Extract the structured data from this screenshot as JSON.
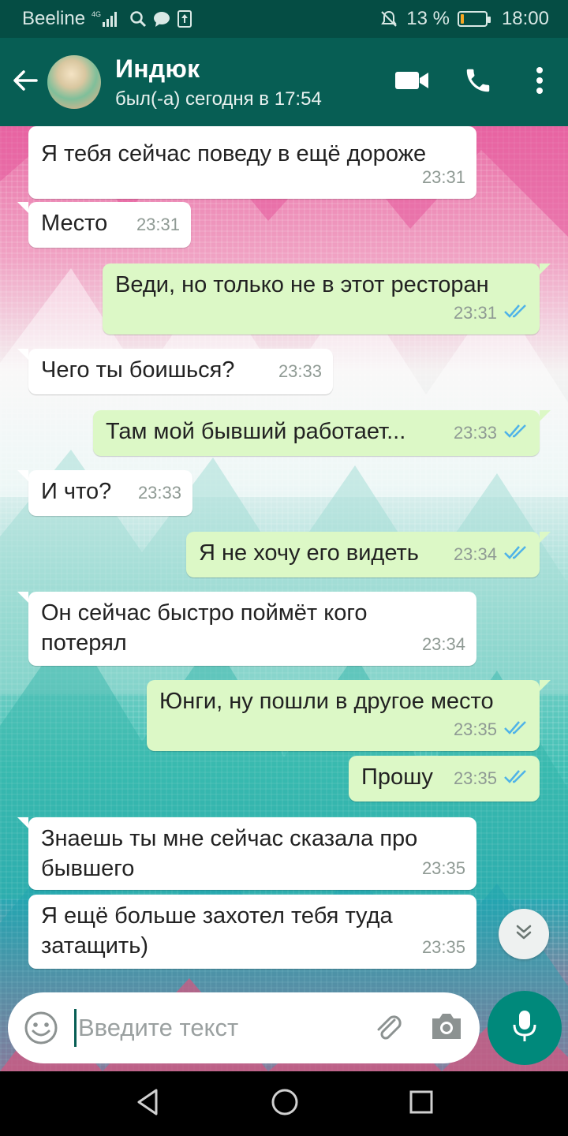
{
  "statusbar": {
    "carrier": "Beeline",
    "network": "4G",
    "battery_text": "13 %",
    "battery_level": 0.13,
    "time": "18:00"
  },
  "header": {
    "contact_name": "Индюк",
    "last_seen": "был(-а) сегодня в 17:54"
  },
  "messages": [
    {
      "dir": "in",
      "text": "Я тебя сейчас поведу в ещё дороже",
      "time": "23:31"
    },
    {
      "dir": "in",
      "text": "Место",
      "time": "23:31"
    },
    {
      "dir": "out",
      "text": "Веди, но только не в этот ресторан",
      "time": "23:31"
    },
    {
      "dir": "in",
      "text": "Чего ты боишься?",
      "time": "23:33"
    },
    {
      "dir": "out",
      "text": "Там мой бывший работает...",
      "time": "23:33"
    },
    {
      "dir": "in",
      "text": "И что?",
      "time": "23:33"
    },
    {
      "dir": "out",
      "text": "Я не хочу его видеть",
      "time": "23:34"
    },
    {
      "dir": "in",
      "text": "Он сейчас быстро поймёт кого потерял",
      "time": "23:34"
    },
    {
      "dir": "out",
      "text": "Юнги, ну пошли в другое место",
      "time": "23:35"
    },
    {
      "dir": "out",
      "text": "Прошу",
      "time": "23:35"
    },
    {
      "dir": "in",
      "text": "Знаешь ты мне сейчас сказала про бывшего",
      "time": "23:35"
    },
    {
      "dir": "in",
      "text": "Я ещё больше захотел тебя туда затащить)",
      "time": "23:35"
    }
  ],
  "input": {
    "placeholder": "Введите текст"
  },
  "colors": {
    "header": "#075e54",
    "statusbar": "#054d44",
    "outgoing_bubble": "#dcf8c6",
    "incoming_bubble": "#ffffff",
    "read_ticks": "#4fb3e8",
    "mic_button": "#00897b"
  },
  "icons": {
    "back": "arrow-left-icon",
    "video": "video-camera-icon",
    "call": "phone-icon",
    "menu": "more-vertical-icon",
    "emoji": "smiley-icon",
    "attach": "paperclip-icon",
    "camera": "camera-icon",
    "mic": "microphone-icon",
    "scroll": "double-chevron-down-icon",
    "read": "double-check-icon"
  }
}
